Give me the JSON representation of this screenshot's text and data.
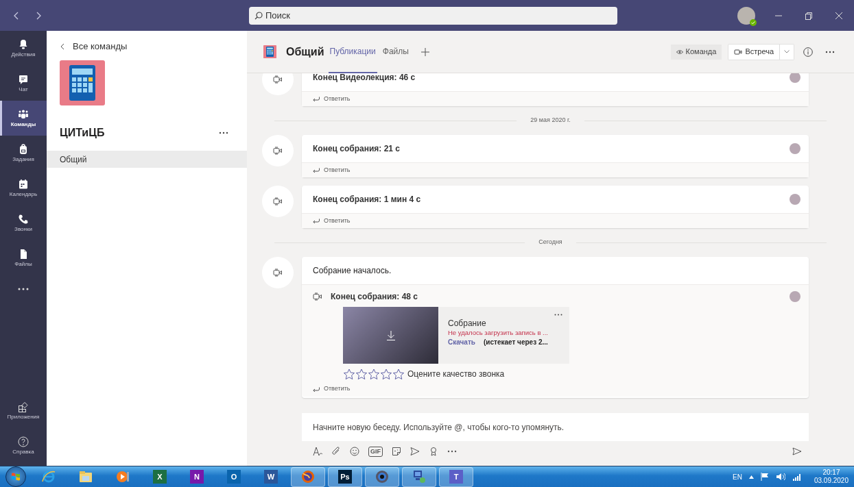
{
  "title_bar": {
    "search_placeholder": "Поиск"
  },
  "rail": {
    "items": [
      {
        "kind": "bell",
        "label": "Действия",
        "selected": false
      },
      {
        "kind": "chat",
        "label": "Чат",
        "selected": false
      },
      {
        "kind": "teams",
        "label": "Команды",
        "selected": true
      },
      {
        "kind": "bag",
        "label": "Задания",
        "selected": false
      },
      {
        "kind": "calendar",
        "label": "Календарь",
        "selected": false
      },
      {
        "kind": "phone",
        "label": "Звонки",
        "selected": false
      },
      {
        "kind": "file",
        "label": "Файлы",
        "selected": false
      }
    ],
    "bottom_items": [
      {
        "kind": "apps",
        "label": "Приложения"
      },
      {
        "kind": "help",
        "label": "Справка"
      }
    ]
  },
  "team_panel": {
    "back_label": "Все команды",
    "team_name": "ЦИТиЦБ",
    "channels": [
      {
        "name": "Общий",
        "selected": true
      }
    ]
  },
  "channel_header": {
    "title": "Общий",
    "tabs": [
      {
        "label": "Публикации",
        "selected": true
      },
      {
        "label": "Файлы",
        "selected": false
      }
    ],
    "team_button": "Команда",
    "meet_button": "Встреча"
  },
  "feed": [
    {
      "kind": "post",
      "title": "Конец Видеолекция: 46 с",
      "reply": "Ответить"
    },
    {
      "kind": "date",
      "label": "29 мая 2020 г."
    },
    {
      "kind": "post",
      "title": "Конец собрания: 21 с",
      "reply": "Ответить"
    },
    {
      "kind": "post",
      "title": "Конец собрания: 1 мин 4 с",
      "reply": "Ответить"
    },
    {
      "kind": "date",
      "label": "Сегодня"
    },
    {
      "kind": "meeting",
      "title": "Собрание началось.",
      "reply": "Ответить",
      "ended": {
        "title": "Конец собрания: 48 с",
        "recording": {
          "name": "Собрание",
          "error": "Не удалось загрузить запись в ...",
          "link": "Скачать",
          "note": "(истекает через 2..."
        },
        "stars": 0,
        "rating_label": "Оцените качество звонка"
      }
    }
  ],
  "compose": {
    "placeholder": "Начните новую беседу. Используйте @, чтобы кого-то упомянуть.",
    "tools": [
      {
        "kind": "format"
      },
      {
        "kind": "attach"
      },
      {
        "kind": "emoji"
      },
      {
        "kind": "gif",
        "label": "GIF"
      },
      {
        "kind": "sticker"
      },
      {
        "kind": "send-later"
      },
      {
        "kind": "praise"
      },
      {
        "kind": "more"
      }
    ]
  },
  "taskbar": {
    "apps": [
      {
        "kind": "ie",
        "running": false
      },
      {
        "kind": "folder",
        "running": false
      },
      {
        "kind": "media",
        "running": false
      },
      {
        "kind": "tile",
        "label": "X",
        "color": "#1d6f42",
        "running": false
      },
      {
        "kind": "tile",
        "label": "N",
        "color": "#7719aa",
        "running": false
      },
      {
        "kind": "tile",
        "label": "O",
        "color": "#0a64ad",
        "running": false
      },
      {
        "kind": "tile",
        "label": "W",
        "color": "#2b579a",
        "running": false
      },
      {
        "kind": "firefox",
        "running": true
      },
      {
        "kind": "tile",
        "label": "Ps",
        "color": "#001e36",
        "running": true
      },
      {
        "kind": "camera",
        "running": true
      },
      {
        "kind": "network",
        "running": true
      },
      {
        "kind": "tile",
        "label": "T",
        "color": "#5b5fc7",
        "running": true
      }
    ],
    "language": "EN",
    "time": "20:17",
    "date": "03.09.2020"
  }
}
